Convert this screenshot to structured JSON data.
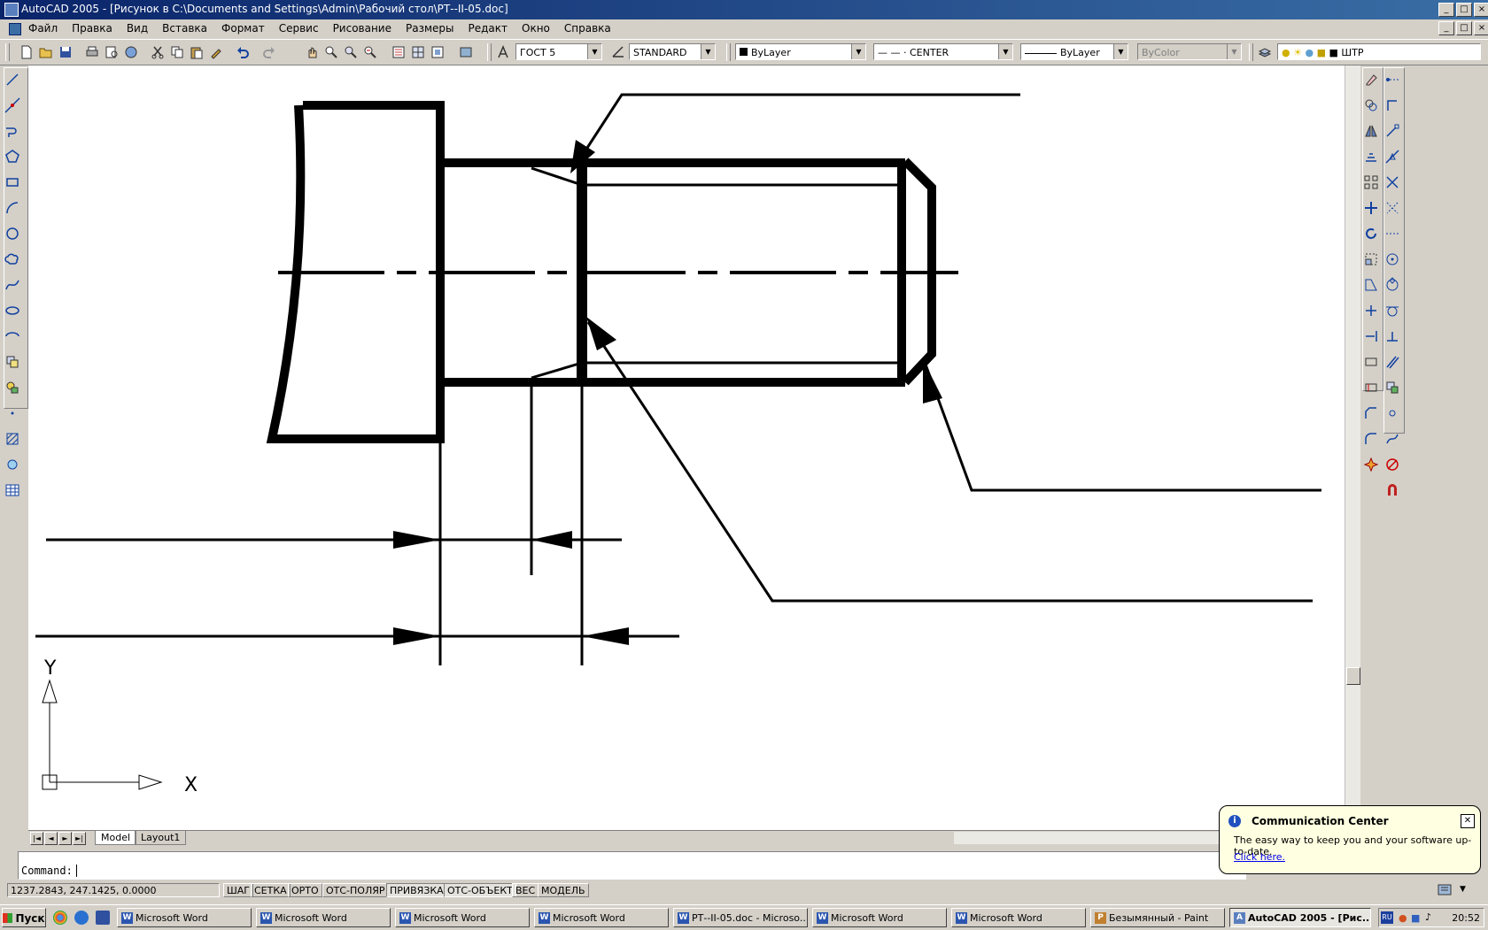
{
  "window": {
    "title": "AutoCAD 2005 - [Рисунок в C:\\Documents and Settings\\Admin\\Рабочий стол\\РТ--II-05.doc]",
    "controls": [
      "_",
      "□",
      "×"
    ]
  },
  "menu": [
    "Файл",
    "Правка",
    "Вид",
    "Вставка",
    "Формат",
    "Сервис",
    "Рисование",
    "Размеры",
    "Редакт",
    "Окно",
    "Справка"
  ],
  "toolbar": {
    "text_style": "ГОСТ 5",
    "dim_style": "STANDARD",
    "color": "ByLayer",
    "linetype": "— — · CENTER",
    "lineweight": "ByLayer",
    "plot_style": "ByColor",
    "layer": "ШТР"
  },
  "ucs": {
    "x_label": "X",
    "y_label": "Y"
  },
  "tabs": {
    "nav": [
      "|◄",
      "◄",
      "►",
      "►|"
    ],
    "model": "Model",
    "layout1": "Layout1"
  },
  "command": {
    "prompt": "Command:",
    "value": ""
  },
  "status": {
    "coords": "1237.2843, 247.1425, 0.0000",
    "modes": [
      {
        "label": "ШАГ",
        "on": false
      },
      {
        "label": "СЕТКА",
        "on": false
      },
      {
        "label": "ОРТО",
        "on": false
      },
      {
        "label": "ОТС-ПОЛЯР",
        "on": false
      },
      {
        "label": "ПРИВЯЗКА",
        "on": true
      },
      {
        "label": "ОТС-ОБЪЕКТ",
        "on": true
      },
      {
        "label": "ВЕС",
        "on": false
      },
      {
        "label": "МОДЕЛЬ",
        "on": false
      }
    ]
  },
  "communication_center": {
    "title": "Communication Center",
    "message": "The easy way to keep you and your software up-to-date.",
    "link": "Click here."
  },
  "taskbar": {
    "start": "Пуск",
    "tasks": [
      {
        "label": "Microsoft Word",
        "icon": "W",
        "active": false
      },
      {
        "label": "Microsoft Word",
        "icon": "W",
        "active": false
      },
      {
        "label": "Microsoft Word",
        "icon": "W",
        "active": false
      },
      {
        "label": "Microsoft Word",
        "icon": "W",
        "active": false
      },
      {
        "label": "РТ--II-05.doc - Microso...",
        "icon": "W",
        "active": false
      },
      {
        "label": "Microsoft Word",
        "icon": "W",
        "active": false
      },
      {
        "label": "Microsoft Word",
        "icon": "W",
        "active": false
      },
      {
        "label": "Безымянный - Paint",
        "icon": "P",
        "active": false
      },
      {
        "label": "AutoCAD 2005 - [Рис...",
        "icon": "A",
        "active": true
      }
    ],
    "tray": {
      "lang": "RU",
      "clock": "20:52"
    }
  }
}
